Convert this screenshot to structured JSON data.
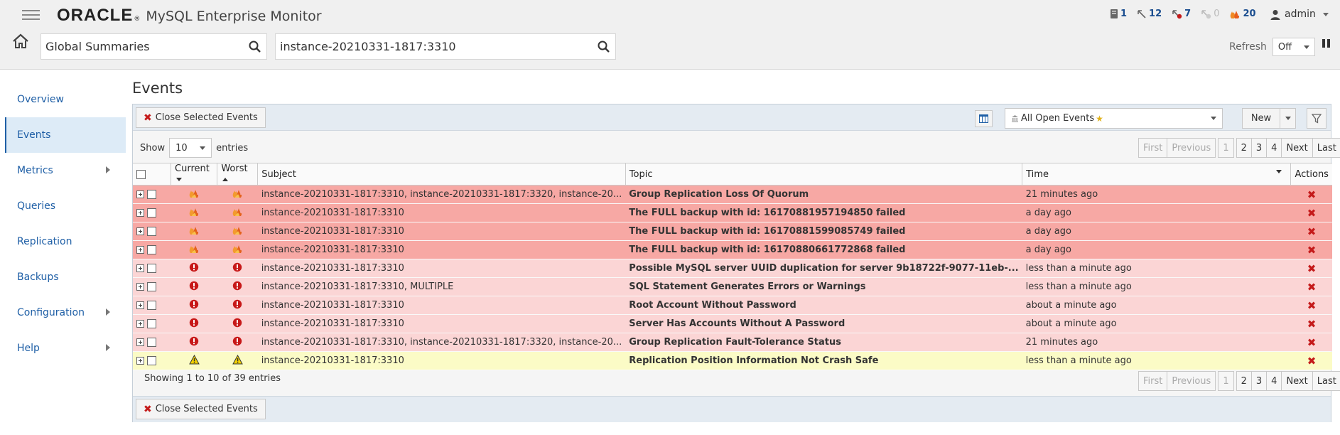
{
  "brand": {
    "oracle": "ORACLE",
    "product": "MySQL Enterprise Monitor"
  },
  "status": [
    {
      "icon": "server-icon",
      "count": "1"
    },
    {
      "icon": "agent-icon",
      "count": "12"
    },
    {
      "icon": "agent-down-icon",
      "count": "7"
    },
    {
      "icon": "unmonitored-icon",
      "count": "0"
    },
    {
      "icon": "emergency-events-icon",
      "count": "20"
    }
  ],
  "user": {
    "name": "admin"
  },
  "search": {
    "global": "Global Summaries",
    "instance": "instance-20210331-1817:3310"
  },
  "refresh": {
    "label": "Refresh",
    "value": "Off"
  },
  "sidebar": {
    "items": [
      {
        "label": "Overview",
        "active": false,
        "submenu": false
      },
      {
        "label": "Events",
        "active": true,
        "submenu": false
      },
      {
        "label": "Metrics",
        "active": false,
        "submenu": true
      },
      {
        "label": "Queries",
        "active": false,
        "submenu": false
      },
      {
        "label": "Replication",
        "active": false,
        "submenu": false
      },
      {
        "label": "Backups",
        "active": false,
        "submenu": false
      },
      {
        "label": "Configuration",
        "active": false,
        "submenu": true
      },
      {
        "label": "Help",
        "active": false,
        "submenu": true
      }
    ]
  },
  "page": {
    "title": "Events"
  },
  "toolbar": {
    "close_selected": "Close Selected Events",
    "filter": "All Open Events",
    "new": "New"
  },
  "length": {
    "show": "Show",
    "value": "10",
    "entries": "entries"
  },
  "pager": {
    "first": "First",
    "previous": "Previous",
    "pages": [
      "1",
      "2",
      "3",
      "4"
    ],
    "next": "Next",
    "last": "Last"
  },
  "table": {
    "headers": {
      "current": "Current",
      "worst": "Worst",
      "subject": "Subject",
      "topic": "Topic",
      "time": "Time",
      "actions": "Actions"
    },
    "rows": [
      {
        "severity": "crit",
        "current": "emergency",
        "worst": "emergency",
        "subject": "instance-20210331-1817:3310, instance-20210331-1817:3320, instance-20...",
        "topic": "Group Replication Loss Of Quorum",
        "time": "21 minutes ago"
      },
      {
        "severity": "crit",
        "current": "emergency",
        "worst": "emergency",
        "subject": "instance-20210331-1817:3310",
        "topic": "The FULL backup with id: 16170881957194850 failed",
        "time": "a day ago"
      },
      {
        "severity": "crit",
        "current": "emergency",
        "worst": "emergency",
        "subject": "instance-20210331-1817:3310",
        "topic": "The FULL backup with id: 16170881599085749 failed",
        "time": "a day ago"
      },
      {
        "severity": "crit",
        "current": "emergency",
        "worst": "emergency",
        "subject": "instance-20210331-1817:3310",
        "topic": "The FULL backup with id: 16170880661772868 failed",
        "time": "a day ago"
      },
      {
        "severity": "err",
        "current": "critical",
        "worst": "critical",
        "subject": "instance-20210331-1817:3310",
        "topic": "Possible MySQL server UUID duplication for server 9b18722f-9077-11eb-...",
        "time": "less than a minute ago"
      },
      {
        "severity": "err",
        "current": "critical",
        "worst": "critical",
        "subject": "instance-20210331-1817:3310, MULTIPLE",
        "topic": "SQL Statement Generates Errors or Warnings",
        "time": "less than a minute ago"
      },
      {
        "severity": "err",
        "current": "critical",
        "worst": "critical",
        "subject": "instance-20210331-1817:3310",
        "topic": "Root Account Without Password",
        "time": "about a minute ago"
      },
      {
        "severity": "err",
        "current": "critical",
        "worst": "critical",
        "subject": "instance-20210331-1817:3310",
        "topic": "Server Has Accounts Without A Password",
        "time": "about a minute ago"
      },
      {
        "severity": "err",
        "current": "critical",
        "worst": "critical",
        "subject": "instance-20210331-1817:3310, instance-20210331-1817:3320, instance-20...",
        "topic": "Group Replication Fault-Tolerance Status",
        "time": "21 minutes ago"
      },
      {
        "severity": "warn",
        "current": "warning",
        "worst": "warning",
        "subject": "instance-20210331-1817:3310",
        "topic": "Replication Position Information Not Crash Safe",
        "time": "less than a minute ago"
      }
    ]
  },
  "info": "Showing 1 to 10 of 39 entries",
  "colors": {
    "emergency_row": "#f7a8a4",
    "critical_row": "#fbd5d5",
    "warning_row": "#fbfbc6",
    "link": "#1f5fa6",
    "close_x": "#c41a1a"
  }
}
